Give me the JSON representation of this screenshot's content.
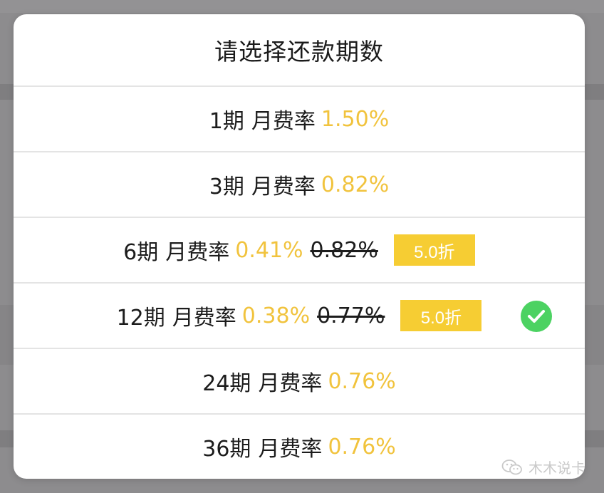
{
  "dialog": {
    "title": "请选择还款期数",
    "rate_label": "月费率",
    "options": [
      {
        "period": "1期",
        "rate": "1.50%",
        "old_rate": null,
        "badge": null,
        "selected": false
      },
      {
        "period": "3期",
        "rate": "0.82%",
        "old_rate": null,
        "badge": null,
        "selected": false
      },
      {
        "period": "6期",
        "rate": "0.41%",
        "old_rate": "0.82%",
        "badge": "5.0折",
        "selected": false
      },
      {
        "period": "12期",
        "rate": "0.38%",
        "old_rate": "0.77%",
        "badge": "5.0折",
        "selected": true
      },
      {
        "period": "24期",
        "rate": "0.76%",
        "old_rate": null,
        "badge": null,
        "selected": false
      },
      {
        "period": "36期",
        "rate": "0.76%",
        "old_rate": null,
        "badge": null,
        "selected": false
      }
    ]
  },
  "watermark": {
    "text": "木木说卡",
    "icon": "wechat-icon"
  },
  "colors": {
    "rate": "#f1c33d",
    "badge": "#f6cd33",
    "check": "#4cd262",
    "overlay": "#8d8c8e"
  }
}
